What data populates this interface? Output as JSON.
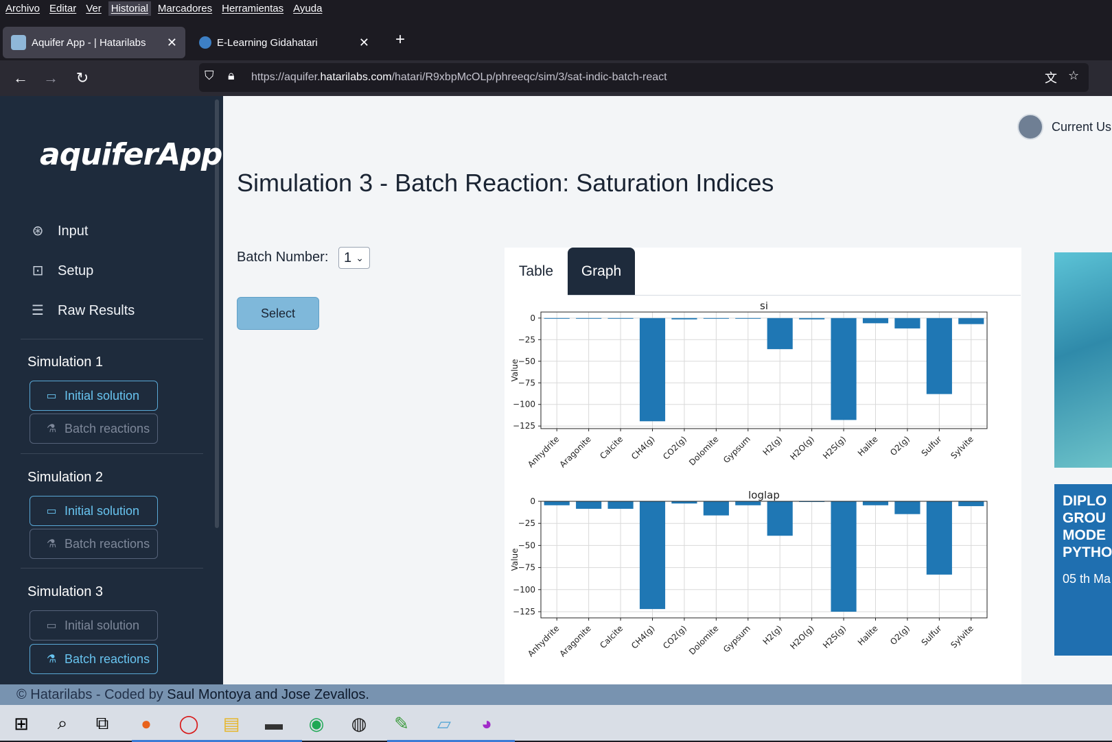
{
  "browser": {
    "menu": [
      "Archivo",
      "Editar",
      "Ver",
      "Historial",
      "Marcadores",
      "Herramientas",
      "Ayuda"
    ],
    "tabs": [
      {
        "title": "Aquifer App - | Hatarilabs",
        "active": true
      },
      {
        "title": "E-Learning Gidahatari",
        "active": false
      }
    ],
    "url_prefix": "https://aquifer.",
    "url_domain": "hatarilabs.com",
    "url_path": "/hatari/R9xbpMcOLp/phreeqc/sim/3/sat-indic-batch-react"
  },
  "sidebar": {
    "logo": "aquiferApp",
    "nav": [
      {
        "label": "Input",
        "icon": "globe-icon"
      },
      {
        "label": "Setup",
        "icon": "terminal-icon"
      },
      {
        "label": "Raw Results",
        "icon": "database-icon"
      }
    ],
    "simulations": [
      {
        "title": "Simulation 1",
        "initial": "Initial solution",
        "batch": "Batch reactions"
      },
      {
        "title": "Simulation 2",
        "initial": "Initial solution",
        "batch": "Batch reactions"
      },
      {
        "title": "Simulation 3",
        "initial": "Initial solution",
        "batch": "Batch reactions"
      }
    ]
  },
  "header": {
    "user": "Current Us"
  },
  "main": {
    "title": "Simulation 3 - Batch Reaction: Saturation Indices",
    "batch_label": "Batch Number:",
    "batch_value": "1",
    "select_button": "Select",
    "tabs": [
      "Table",
      "Graph"
    ]
  },
  "ad": {
    "lines": [
      "DIPLO",
      "GROU",
      "MODE",
      "PYTHO"
    ],
    "date": "05 th Ma"
  },
  "footer": {
    "prefix": "© Hatarilabs - Coded by ",
    "authors": "Saul Montoya and Jose Zevallos."
  },
  "chart_data": [
    {
      "type": "bar",
      "title": "si",
      "ylabel": "Value",
      "xlabel": "",
      "ylim": [
        -128,
        7
      ],
      "yticks": [
        0,
        -25,
        -50,
        -75,
        -100,
        -125
      ],
      "categories": [
        "Anhydrite",
        "Aragonite",
        "Calcite",
        "CH4(g)",
        "CO2(g)",
        "Dolomite",
        "Gypsum",
        "H2(g)",
        "H2O(g)",
        "H2S(g)",
        "Halite",
        "O2(g)",
        "Sulfur",
        "Sylvite"
      ],
      "values": [
        -0.3,
        -0.4,
        -0.2,
        -119.5,
        -1.5,
        -0.6,
        -0.3,
        -36,
        -1.5,
        -118,
        -6,
        -12,
        -88,
        -7
      ],
      "color": "#1f77b4",
      "grid": true
    },
    {
      "type": "bar",
      "title": "loglap",
      "ylabel": "Value",
      "xlabel": "",
      "ylim": [
        -132,
        0
      ],
      "yticks": [
        0,
        -25,
        -50,
        -75,
        -100,
        -125
      ],
      "categories": [
        "Anhydrite",
        "Aragonite",
        "Calcite",
        "CH4(g)",
        "CO2(g)",
        "Dolomite",
        "Gypsum",
        "H2(g)",
        "H2O(g)",
        "H2S(g)",
        "Halite",
        "O2(g)",
        "Sulfur",
        "Sylvite"
      ],
      "values": [
        -4.5,
        -8.5,
        -8.5,
        -122,
        -2.5,
        -16,
        -4.5,
        -39,
        -0.5,
        -125,
        -4.5,
        -14.5,
        -83,
        -5.5
      ],
      "color": "#1f77b4",
      "grid": true
    }
  ]
}
